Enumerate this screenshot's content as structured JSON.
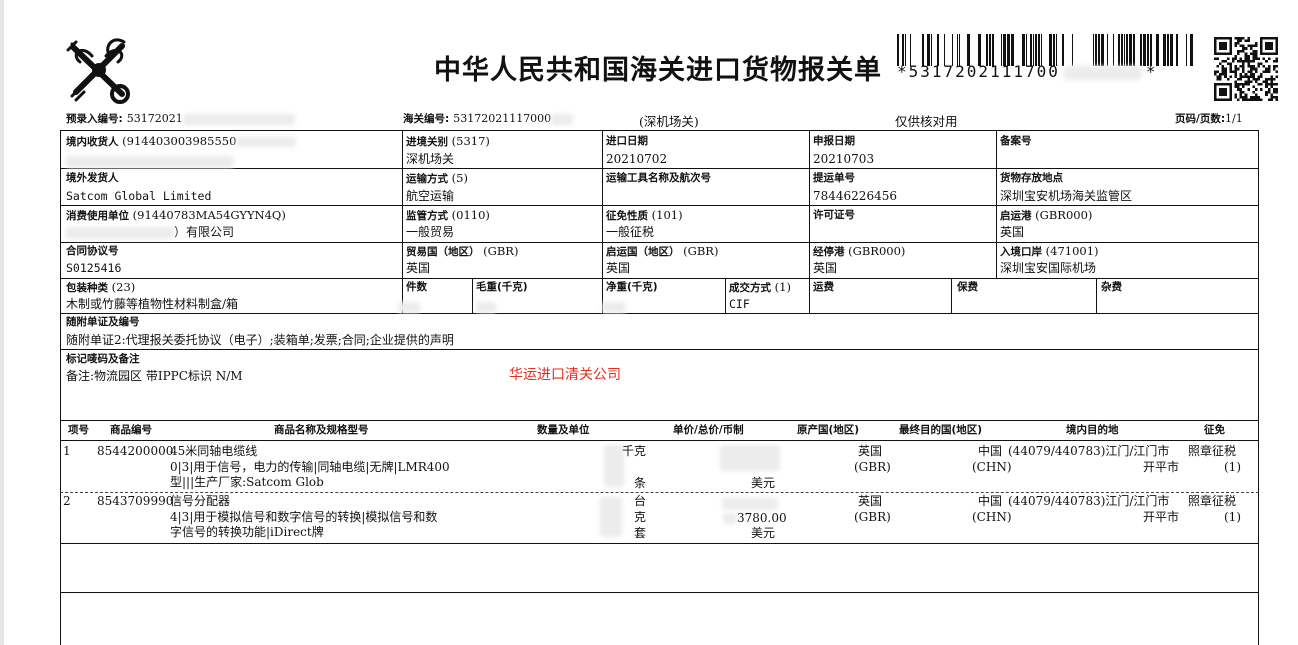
{
  "header": {
    "title": "中华人民共和国海关进口货物报关单",
    "barcode_text": "*5317202111700",
    "barcode_end": "*",
    "pre_entry_label": "预录入编号:",
    "pre_entry_value": "53172021",
    "customs_no_label": "海关编号:",
    "customs_no_value": "53172021117000",
    "customs_office": "(深机场关)",
    "verify_note": "仅供核对用",
    "page_label": "页码/页数:",
    "page_value": "1/1"
  },
  "fields": {
    "consignee_label": "境内收货人",
    "consignee_code": "(914403003985550",
    "entry_office_label": "进境关别",
    "entry_office_code": "(5317)",
    "entry_office_value": "深机场关",
    "import_date_label": "进口日期",
    "import_date_value": "20210702",
    "declare_date_label": "申报日期",
    "declare_date_value": "20210703",
    "record_no_label": "备案号",
    "shipper_label": "境外发货人",
    "shipper_value": "Satcom Global Limited",
    "transport_mode_label": "运输方式",
    "transport_mode_code": "(5)",
    "transport_mode_value": "航空运输",
    "vessel_label": "运输工具名称及航次号",
    "bl_label": "提运单号",
    "bl_value": "78446226456",
    "storage_label": "货物存放地点",
    "storage_value": "深圳宝安机场海关监管区",
    "consumer_label": "消费使用单位",
    "consumer_code": "(91440783MA54GYYN4Q)",
    "consumer_value": "）有限公司",
    "supervision_label": "监管方式",
    "supervision_code": "(0110)",
    "supervision_value": "一般贸易",
    "levy_label": "征免性质",
    "levy_code": "(101)",
    "levy_value": "一般征税",
    "license_label": "许可证号",
    "departure_port_label": "启运港",
    "departure_port_code": "(GBR000)",
    "departure_port_value": "英国",
    "contract_label": "合同协议号",
    "contract_value": "S0125416",
    "trade_country_label": "贸易国（地区）",
    "trade_country_code": "(GBR)",
    "trade_country_value": "英国",
    "origin_country_label": "启运国（地区）",
    "origin_country_code": "(GBR)",
    "origin_country_value": "英国",
    "stop_port_label": "经停港",
    "stop_port_code": "(GBR000)",
    "stop_port_value": "英国",
    "entry_port_label": "入境口岸",
    "entry_port_code": "(471001)",
    "entry_port_value": "深圳宝安国际机场",
    "package_label": "包装种类",
    "package_code": "(23)",
    "package_value": "木制或竹藤等植物性材料制盒/箱",
    "pieces_label": "件数",
    "gross_label": "毛重(千克)",
    "net_label": "净重(千克)",
    "deal_label": "成交方式",
    "deal_code": "(1)",
    "deal_value": "CIF",
    "freight_label": "运费",
    "insurance_label": "保费",
    "misc_label": "杂费",
    "docs_label": "随附单证及编号",
    "docs_value": "随附单证2:代理报关委托协议（电子）;装箱单;发票;合同;企业提供的声明",
    "marks_label": "标记唛码及备注",
    "marks_value": "备注:物流园区 带IPPC标识 N/M",
    "stamp": "华运进口清关公司"
  },
  "goods_headers": {
    "no": "项号",
    "code": "商品编号",
    "name": "商品名称及规格型号",
    "qty": "数量及单位",
    "price": "单价/总价/币制",
    "origin": "原产国(地区)",
    "dest_country": "最终目的国(地区)",
    "dest_place": "境内目的地",
    "levy": "征免"
  },
  "goods": [
    {
      "no": "1",
      "code": "8544200000",
      "name": "45米同轴电缆线",
      "spec1": "0|3|用于信号，电力的传输|同轴电缆|无牌|LMR400",
      "spec2": "型|||生产厂家:Satcom Glob",
      "unit1": "千克",
      "unit2": "条",
      "currency": "美元",
      "origin": "英国",
      "origin_code": "(GBR)",
      "dest_country": "中国",
      "dest_country_code": "(CHN)",
      "dest_place": "(44079/440783)江门/江门市",
      "dest_place2": "开平市",
      "levy": "照章征税",
      "levy_code": "(1)"
    },
    {
      "no": "2",
      "code": "8543709990",
      "name": "信号分配器",
      "spec1": "4|3|用于模拟信号和数字信号的转换|模拟信号和数",
      "spec2": "字信号的转换功能|iDirect牌",
      "unit1": "台",
      "unit2": "克",
      "unit3": "套",
      "total_partial": "3780.00",
      "currency": "美元",
      "origin": "英国",
      "origin_code": "(GBR)",
      "dest_country": "中国",
      "dest_country_code": "(CHN)",
      "dest_place": "(44079/440783)江门/江门市",
      "dest_place2": "开平市",
      "levy": "照章征税",
      "levy_code": "(1)"
    }
  ]
}
